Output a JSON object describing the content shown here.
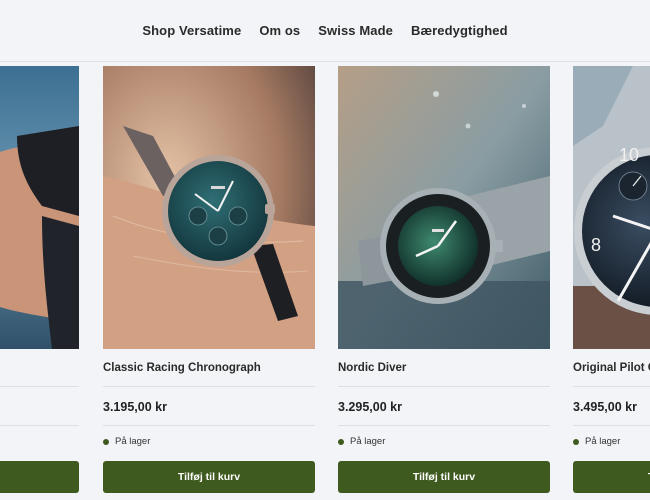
{
  "nav": {
    "items": [
      {
        "label": "Shop Versatime"
      },
      {
        "label": "Om os"
      },
      {
        "label": "Swiss Made"
      },
      {
        "label": "Bæredygtighed"
      }
    ]
  },
  "products": [
    {
      "title": "",
      "price": "",
      "stock": "",
      "button": ""
    },
    {
      "title": "Classic Racing Chronograph",
      "price": "3.195,00 kr",
      "stock": "På lager",
      "button": "Tilføj til kurv"
    },
    {
      "title": "Nordic Diver",
      "price": "3.295,00 kr",
      "stock": "På lager",
      "button": "Tilføj til kurv"
    },
    {
      "title": "Original Pilot C",
      "price": "3.495,00 kr",
      "stock": "På lager",
      "button": "Tilføj til kurv"
    }
  ],
  "colors": {
    "accent": "#3f5a1f",
    "background": "#f3f4f7"
  }
}
